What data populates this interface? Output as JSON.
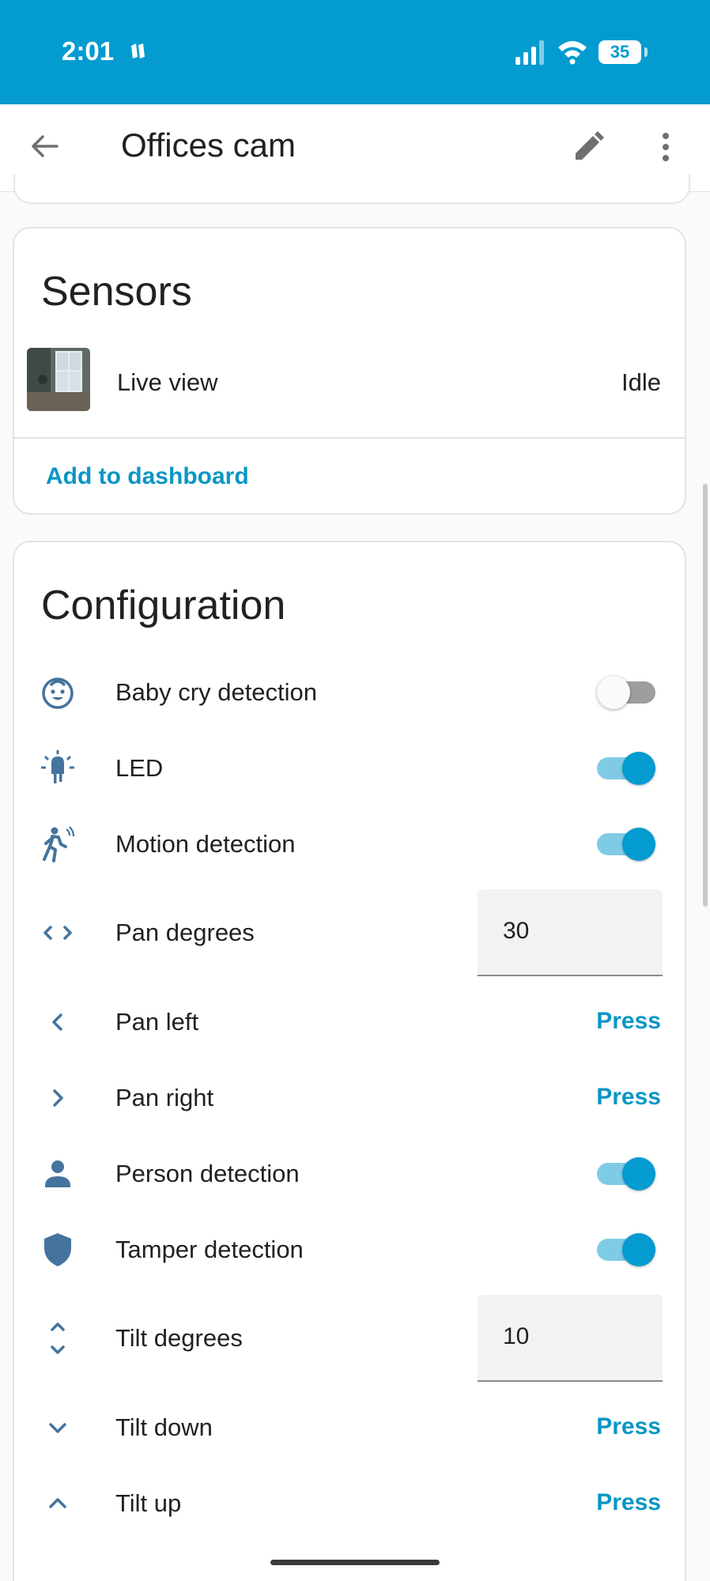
{
  "status_bar": {
    "time": "2:01",
    "battery": "35"
  },
  "app_bar": {
    "title": "Offices cam"
  },
  "sensors": {
    "title": "Sensors",
    "item": {
      "label": "Live view",
      "state": "Idle"
    },
    "add_link": "Add to dashboard"
  },
  "configuration": {
    "title": "Configuration",
    "items": [
      {
        "label": "Baby cry detection",
        "type": "toggle",
        "on": false,
        "icon": "baby-face-icon"
      },
      {
        "label": "LED",
        "type": "toggle",
        "on": true,
        "icon": "led-icon"
      },
      {
        "label": "Motion detection",
        "type": "toggle",
        "on": true,
        "icon": "motion-sensor-icon"
      },
      {
        "label": "Pan degrees",
        "type": "number",
        "value": "30",
        "icon": "pan-horizontal-icon"
      },
      {
        "label": "Pan left",
        "type": "button",
        "action": "Press",
        "icon": "chevron-left-icon"
      },
      {
        "label": "Pan right",
        "type": "button",
        "action": "Press",
        "icon": "chevron-right-icon"
      },
      {
        "label": "Person detection",
        "type": "toggle",
        "on": true,
        "icon": "person-icon"
      },
      {
        "label": "Tamper detection",
        "type": "toggle",
        "on": true,
        "icon": "shield-icon"
      },
      {
        "label": "Tilt degrees",
        "type": "number",
        "value": "10",
        "icon": "pan-vertical-icon"
      },
      {
        "label": "Tilt down",
        "type": "button",
        "action": "Press",
        "icon": "chevron-down-icon"
      },
      {
        "label": "Tilt up",
        "type": "button",
        "action": "Press",
        "icon": "chevron-up-icon"
      }
    ]
  },
  "colors": {
    "accent": "#039bd0",
    "icon": "#44739e",
    "link": "#0a96c4"
  }
}
